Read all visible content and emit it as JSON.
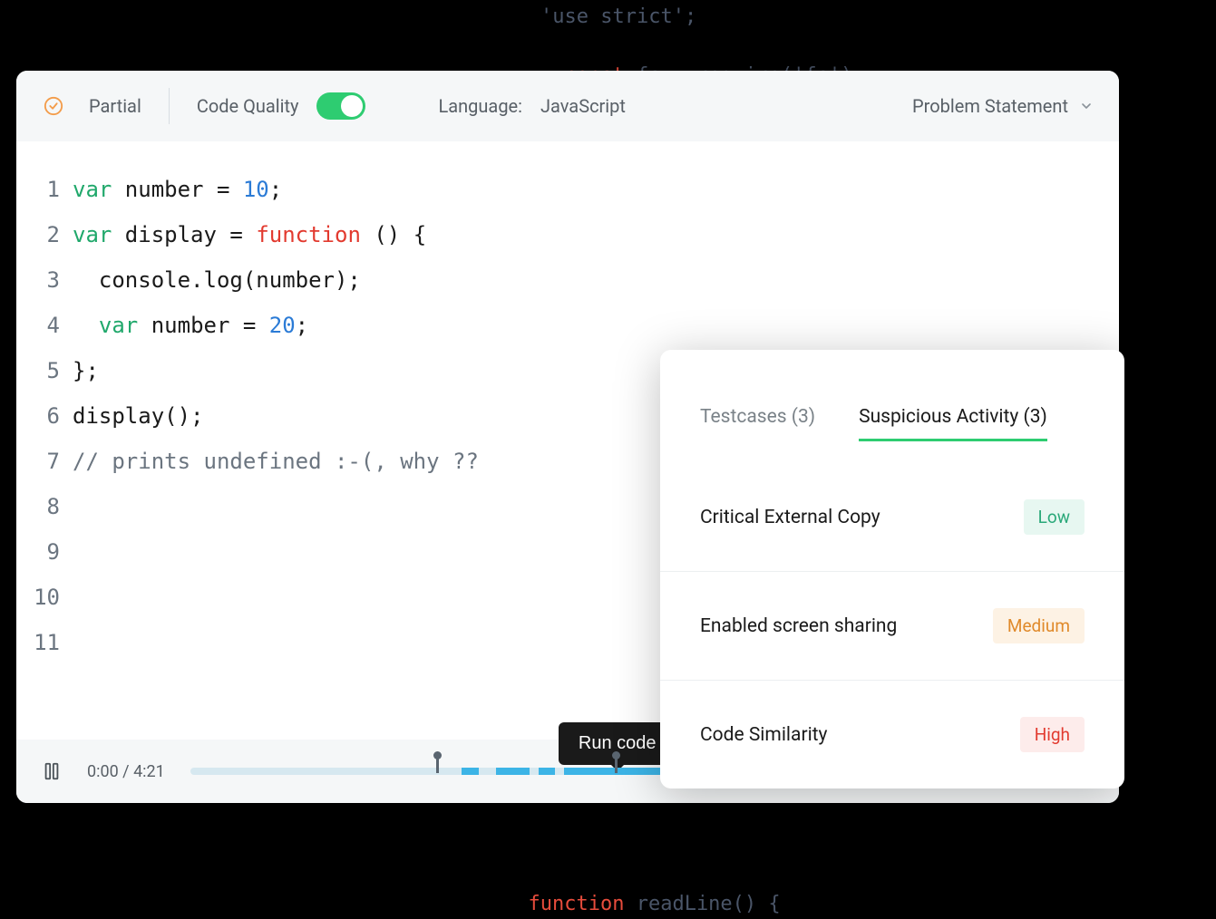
{
  "bg_code": {
    "line1": "'use strict';",
    "line2_kw": "const",
    "line2_rest": " fs = require('fs');",
    "line_bottom_kw": "function",
    "line_bottom_rest": " readLine() {"
  },
  "toolbar": {
    "status_label": "Partial",
    "quality_label": "Code Quality",
    "quality_on": true,
    "language_label": "Language:",
    "language_value": "JavaScript",
    "dropdown_label": "Problem Statement"
  },
  "code": {
    "lines": [
      {
        "n": "1",
        "html": "<span class='tok-kw'>var</span> number = <span class='tok-num'>10</span>;"
      },
      {
        "n": "2",
        "html": "<span class='tok-kw'>var</span> display = <span class='tok-fn'>function</span> () {"
      },
      {
        "n": "3",
        "html": "  console.log(number);"
      },
      {
        "n": "4",
        "html": "  <span class='tok-kw'>var</span> number = <span class='tok-num'>20</span>;"
      },
      {
        "n": "5",
        "html": "};"
      },
      {
        "n": "6",
        "html": "display();"
      },
      {
        "n": "7",
        "html": "<span class='tok-comment'>// prints undefined :-(, why ??</span>"
      },
      {
        "n": "8",
        "html": ""
      },
      {
        "n": "9",
        "html": ""
      },
      {
        "n": "10",
        "html": ""
      },
      {
        "n": "11",
        "html": ""
      }
    ]
  },
  "playback": {
    "time": "0:00 / 4:21",
    "tooltip": "Run code",
    "thumb_pos_pct": 80,
    "markers": [
      {
        "pos_pct": 29,
        "kind": "grey"
      },
      {
        "pos_pct": 50,
        "kind": "grey"
      },
      {
        "pos_pct": 89,
        "kind": "red"
      }
    ],
    "segments": [
      {
        "left_pct": 32,
        "width_pct": 2
      },
      {
        "left_pct": 36,
        "width_pct": 4
      },
      {
        "left_pct": 41,
        "width_pct": 2
      },
      {
        "left_pct": 44,
        "width_pct": 22
      },
      {
        "left_pct": 68,
        "width_pct": 12
      }
    ]
  },
  "side_panel": {
    "tabs": [
      {
        "label": "Testcases (3)",
        "active": false
      },
      {
        "label": "Suspicious Activity (3)",
        "active": true
      }
    ],
    "rows": [
      {
        "label": "Critical External Copy",
        "level": "Low",
        "cls": "low"
      },
      {
        "label": "Enabled screen sharing",
        "level": "Medium",
        "cls": "medium"
      },
      {
        "label": "Code Similarity",
        "level": "High",
        "cls": "high"
      }
    ]
  }
}
